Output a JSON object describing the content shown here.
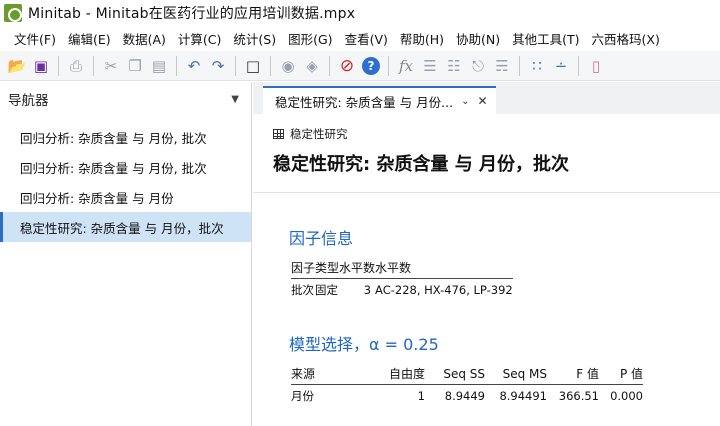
{
  "window": {
    "title": "Minitab - Minitab在医药行业的应用培训数据.mpx"
  },
  "menu": {
    "items": [
      "文件(F)",
      "编辑(E)",
      "数据(A)",
      "计算(C)",
      "统计(S)",
      "图形(G)",
      "查看(V)",
      "帮助(H)",
      "协助(N)",
      "其他工具(T)",
      "六西格玛(X)"
    ]
  },
  "toolbar": {
    "icons": [
      "open-folder-icon",
      "save-icon",
      "print-icon",
      "cut-icon",
      "copy-icon",
      "paste-icon",
      "undo-icon",
      "redo-icon",
      "window-icon",
      "find-icon",
      "replace-icon",
      "stop-icon",
      "help-icon",
      "fx-icon",
      "chart-builder-icon",
      "layout-icon",
      "hierarchy-icon",
      "tree-icon",
      "scatter-icon",
      "scatter-edit-icon",
      "eraser-icon"
    ]
  },
  "navigator": {
    "title": "导航器",
    "items": [
      {
        "label": "回归分析: 杂质含量 与 月份, 批次",
        "selected": false
      },
      {
        "label": "回归分析: 杂质含量 与 月份, 批次",
        "selected": false
      },
      {
        "label": "回归分析: 杂质含量 与 月份",
        "selected": false
      },
      {
        "label": "稳定性研究: 杂质含量 与 月份，批次",
        "selected": true
      }
    ]
  },
  "tab": {
    "label": "稳定性研究: 杂质含量 与 月份..."
  },
  "output": {
    "subtitle": "稳定性研究",
    "title": "稳定性研究: 杂质含量 与 月份，批次",
    "factor_info": {
      "heading": "因子信息",
      "columns": [
        "因子",
        "类型",
        "水平数",
        "水平数"
      ],
      "rows": [
        [
          "批次",
          "固定",
          "3",
          "AC-228, HX-476, LP-392"
        ]
      ]
    },
    "model_selection": {
      "heading": "模型选择，α = 0.25",
      "columns": [
        "来源",
        "自由度",
        "Seq SS",
        "Seq MS",
        "F 值",
        "P 值"
      ],
      "rows": [
        [
          "月份",
          "1",
          "8.9449",
          "8.94491",
          "366.51",
          "0.000"
        ]
      ]
    }
  },
  "colors": {
    "accent": "#2067c4",
    "selected_bg": "#cfe3f7",
    "tab_border": "#2b6fc4"
  }
}
